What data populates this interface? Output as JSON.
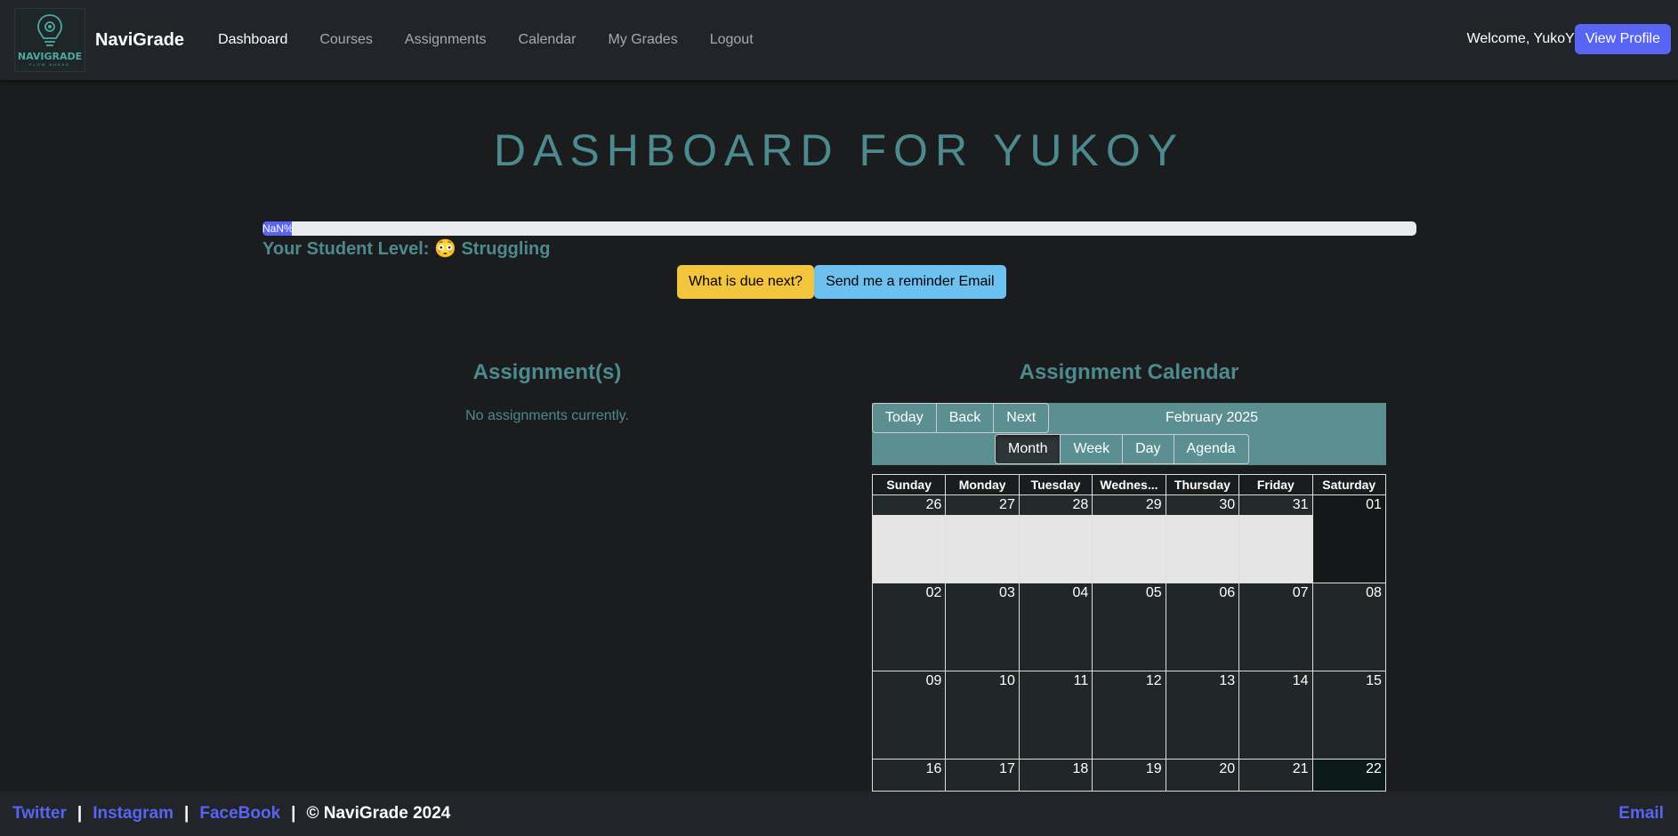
{
  "nav": {
    "logo_text": "NAVIGRADE",
    "logo_sub": "FLOW AHEAD",
    "brand": "NaviGrade",
    "links": [
      "Dashboard",
      "Courses",
      "Assignments",
      "Calendar",
      "My Grades",
      "Logout"
    ],
    "welcome": "Welcome, YukoY",
    "profile_button": "View Profile"
  },
  "main": {
    "title": "DASHBOARD FOR YUKOY",
    "progress_label": "NaN%",
    "level_prefix": "Your Student Level:",
    "level_emoji": "😳",
    "level_value": "Struggling",
    "due_button": "What is due next?",
    "reminder_button": "Send me a reminder Email"
  },
  "assignments": {
    "title": "Assignment(s)",
    "empty_text": "No assignments currently."
  },
  "calendar": {
    "title": "Assignment Calendar",
    "nav_buttons": [
      "Today",
      "Back",
      "Next"
    ],
    "label": "February 2025",
    "view_buttons": [
      "Month",
      "Week",
      "Day",
      "Agenda"
    ],
    "active_view": "Month",
    "weekdays": [
      "Sunday",
      "Monday",
      "Tuesday",
      "Wednesday",
      "Thursday",
      "Friday",
      "Saturday"
    ],
    "weekday_display": [
      "Sunday",
      "Monday",
      "Tuesday",
      "Wednes...",
      "Thursday",
      "Friday",
      "Saturday"
    ],
    "weeks": [
      [
        "26",
        "27",
        "28",
        "29",
        "30",
        "31",
        "01"
      ],
      [
        "02",
        "03",
        "04",
        "05",
        "06",
        "07",
        "08"
      ],
      [
        "09",
        "10",
        "11",
        "12",
        "13",
        "14",
        "15"
      ],
      [
        "16",
        "17",
        "18",
        "19",
        "20",
        "21",
        "22"
      ]
    ]
  },
  "footer": {
    "links": [
      "Twitter",
      "Instagram",
      "FaceBook"
    ],
    "separator": "|",
    "copyright": "© NaviGrade 2024",
    "email": "Email"
  },
  "colors": {
    "accent": "#5865f2",
    "teal": "#4d8a8e",
    "toolbar": "#5b8f92",
    "due_button": "#f2c53d",
    "reminder_button": "#6cc1f0"
  }
}
